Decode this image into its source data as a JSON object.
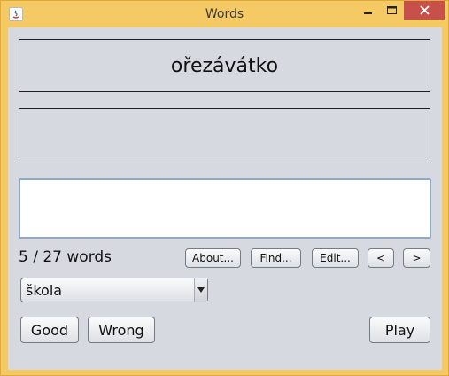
{
  "window": {
    "title": "Words",
    "colors": {
      "frame": "#f5c964",
      "close": "#c7504a",
      "client": "#d6d9e0"
    }
  },
  "word": {
    "text": "ořezávátko"
  },
  "translation": {
    "text": ""
  },
  "answer_input": {
    "value": "",
    "placeholder": ""
  },
  "progress": {
    "text": "5 / 27 words"
  },
  "buttons": {
    "about": "About...",
    "find": "Find...",
    "edit": "Edit...",
    "prev": "<",
    "next": ">",
    "good": "Good",
    "wrong": "Wrong",
    "play": "Play"
  },
  "lesson_select": {
    "selected": "škola"
  }
}
